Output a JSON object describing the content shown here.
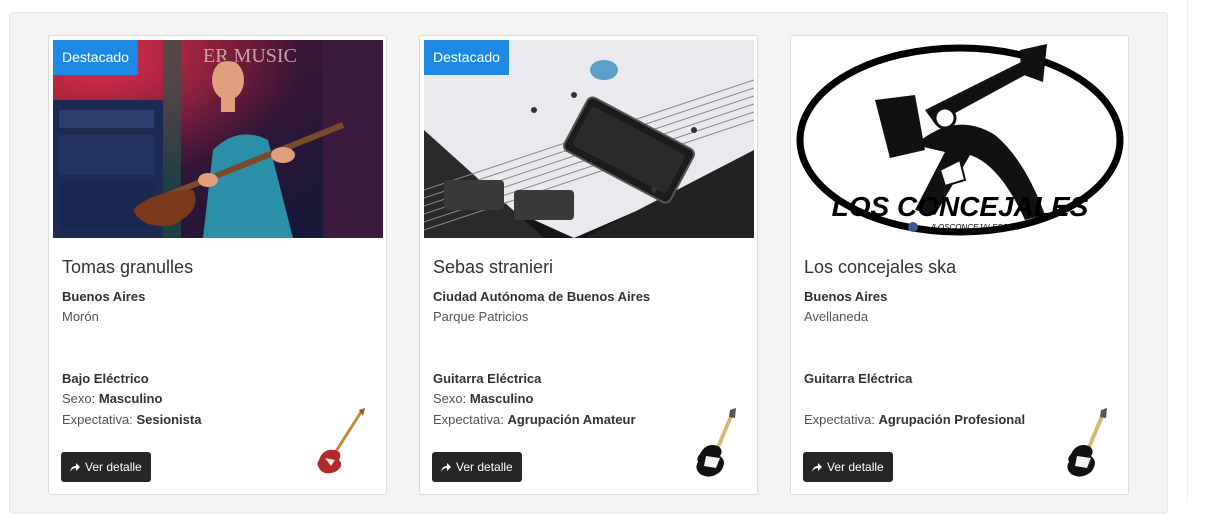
{
  "cards": [
    {
      "badge": "Destacado",
      "name": "Tomas granulles",
      "province": "Buenos Aires",
      "city": "Morón",
      "instrument": "Bajo Eléctrico",
      "sexo_label": "Sexo: ",
      "sexo_value": "Masculino",
      "expect_label": "Expectativa: ",
      "expect_value": "Sesionista",
      "button": "Ver detalle",
      "icon": "bass-guitar-icon",
      "photo_text": "ER MUSIC"
    },
    {
      "badge": "Destacado",
      "name": "Sebas stranieri",
      "province": "Ciudad Autónoma de Buenos Aires",
      "city": "Parque Patricios",
      "instrument": "Guitarra Eléctrica",
      "sexo_label": "Sexo: ",
      "sexo_value": "Masculino",
      "expect_label": "Expectativa: ",
      "expect_value": "Agrupación Amateur",
      "button": "Ver detalle",
      "icon": "electric-guitar-icon"
    },
    {
      "name": "Los concejales ska",
      "province": "Buenos Aires",
      "city": "Avellaneda",
      "instrument": "Guitarra Eléctrica",
      "expect_label": "Expectativa: ",
      "expect_value": "Agrupación Profesional",
      "button": "Ver detalle",
      "icon": "electric-guitar-icon",
      "logo_text": "LOS CONCEJALES",
      "logo_sub": "/LOSCONCEJALESSKA"
    }
  ],
  "colors": {
    "badge": "#1e88e5",
    "button": "#262626"
  }
}
